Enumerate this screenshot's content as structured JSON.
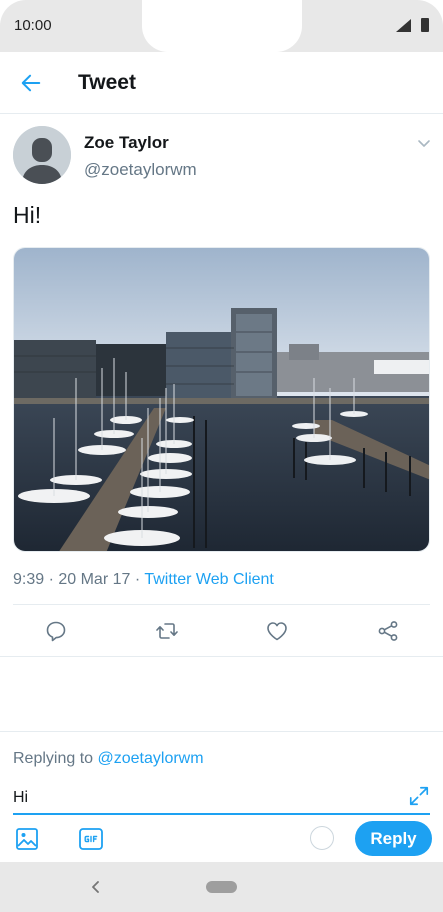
{
  "status_bar": {
    "time": "10:00",
    "signal_icon": "signal-icon",
    "battery_icon": "battery-icon"
  },
  "app_bar": {
    "title": "Tweet",
    "back_icon": "arrow-left-icon"
  },
  "tweet": {
    "author_name": "Zoe Taylor",
    "author_handle": "@zoetaylorwm",
    "text": "Hi!",
    "time": "9:39",
    "date": "20 Mar 17",
    "separator": " · ",
    "source": "Twitter Web Client"
  },
  "actions": [
    "reply-icon",
    "retweet-icon",
    "like-icon",
    "share-icon"
  ],
  "composer": {
    "replying_prefix": "Replying to ",
    "replying_handle": "@zoetaylorwm",
    "input_value": "Hi",
    "reply_label": "Reply"
  },
  "colors": {
    "accent": "#1da1f2",
    "secondary_text": "#657786",
    "primary_text": "#14171a",
    "divider": "#e6ecf0"
  }
}
